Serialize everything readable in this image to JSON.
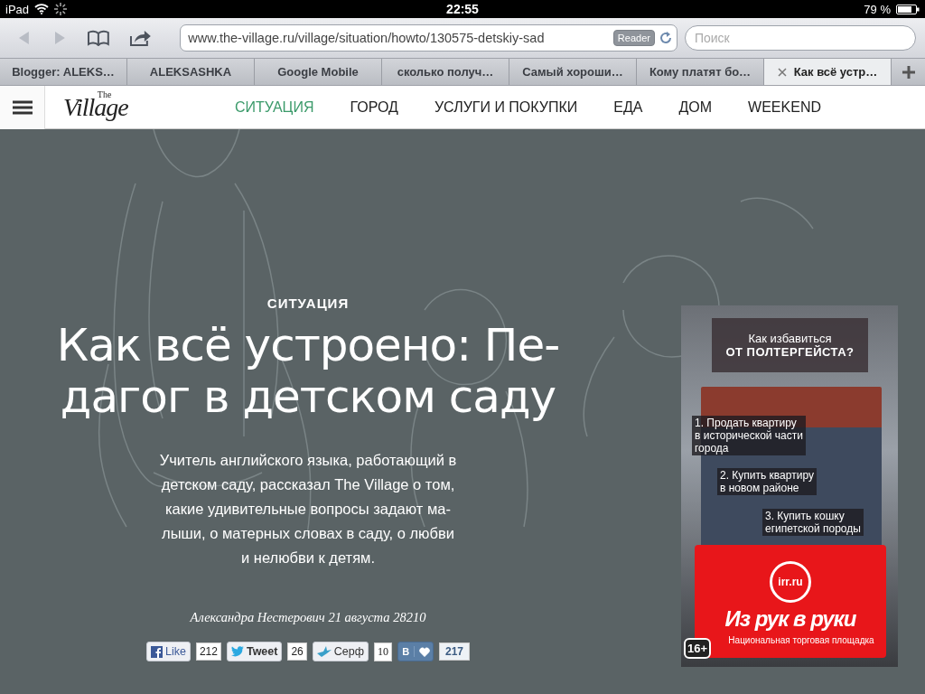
{
  "status_bar": {
    "device": "iPad",
    "time": "22:55",
    "battery": "79 %"
  },
  "toolbar": {
    "url": "www.the-village.ru/village/situation/howto/130575-detskiy-sad",
    "reader": "Reader",
    "search": {
      "placeholder": "Поиск"
    }
  },
  "tabs": [
    {
      "label": "Blogger: ALEKS…",
      "selected": false
    },
    {
      "label": "ALEKSASHKA",
      "selected": false
    },
    {
      "label": "Google Mobile",
      "selected": false
    },
    {
      "label": "сколько получ…",
      "selected": false
    },
    {
      "label": "Самый хороши…",
      "selected": false
    },
    {
      "label": "Кому платят бо…",
      "selected": false
    },
    {
      "label": "Как всё устр…",
      "selected": true
    }
  ],
  "site_nav": {
    "logo_small": "The",
    "logo": "Village",
    "items": [
      {
        "label": "СИТУАЦИЯ",
        "selected": true
      },
      {
        "label": "ГОРОД",
        "selected": false
      },
      {
        "label": "УСЛУГИ И ПОКУПКИ",
        "selected": false
      },
      {
        "label": "ЕДА",
        "selected": false
      },
      {
        "label": "ДОМ",
        "selected": false
      },
      {
        "label": "WEEKEND",
        "selected": false
      }
    ]
  },
  "article": {
    "rubric": "СИТУАЦИЯ",
    "title_lines": [
      "Как всё устроено: Пе-",
      "дагог в детском саду"
    ],
    "lead_lines": [
      "Учитель английского языка, работающий в",
      "детском саду, рассказал The Village о том,",
      "какие удивительные вопросы задают ма-",
      "лыши, о матерных словах в саду, о любви",
      "и нелюбви к детям."
    ],
    "byline": "Александра Нестерович 21 августа 28210",
    "share": [
      {
        "kind": "facebook",
        "label": "Like",
        "count": "212"
      },
      {
        "kind": "twitter",
        "label": "Tweet",
        "count": "26"
      },
      {
        "kind": "surf",
        "label": "Серф",
        "count": "10"
      },
      {
        "kind": "vk",
        "label": "В",
        "count": "217"
      }
    ]
  },
  "ad": {
    "headline_1": "Как избавиться",
    "headline_2": "ОТ ПОЛТЕРГЕЙСТА?",
    "options": [
      [
        "1. Продать квартиру",
        "в исторической части",
        "города"
      ],
      [
        "2. Купить квартиру",
        "в новом районе"
      ],
      [
        "3. Купить кошку",
        "египетской породы"
      ]
    ],
    "brand_site": "irr.ru",
    "brand": "Из рук в руки",
    "tagline": "Национальная торговая площадка",
    "age": "16+"
  }
}
